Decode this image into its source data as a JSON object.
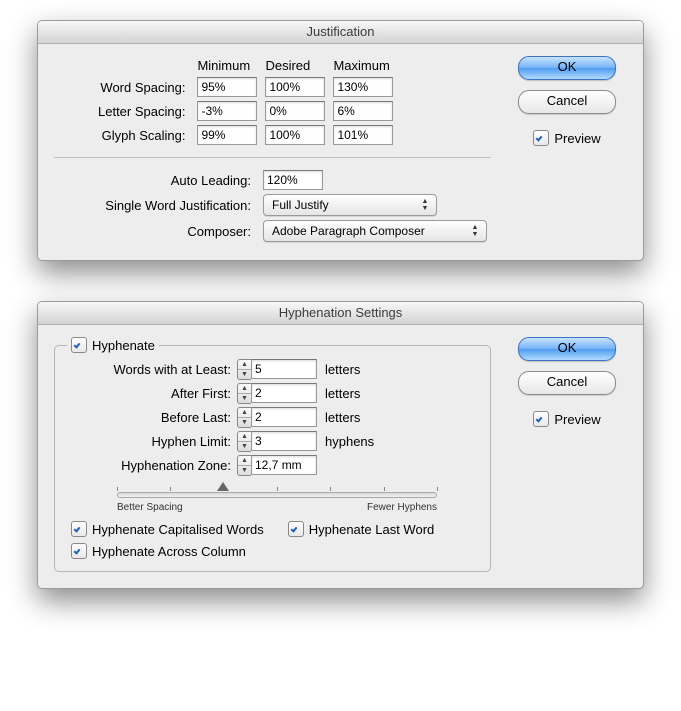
{
  "justification": {
    "title": "Justification",
    "columns": {
      "min": "Minimum",
      "des": "Desired",
      "max": "Maximum"
    },
    "rows": {
      "word": {
        "label": "Word Spacing:",
        "min": "95%",
        "des": "100%",
        "max": "130%"
      },
      "letter": {
        "label": "Letter Spacing:",
        "min": "-3%",
        "des": "0%",
        "max": "6%"
      },
      "glyph": {
        "label": "Glyph Scaling:",
        "min": "99%",
        "des": "100%",
        "max": "101%"
      }
    },
    "auto_leading": {
      "label": "Auto Leading:",
      "value": "120%"
    },
    "single_word": {
      "label": "Single Word Justification:",
      "value": "Full Justify"
    },
    "composer": {
      "label": "Composer:",
      "value": "Adobe Paragraph Composer"
    },
    "buttons": {
      "ok": "OK",
      "cancel": "Cancel"
    },
    "preview": "Preview"
  },
  "hyphenation": {
    "title": "Hyphenation Settings",
    "hyphenate": "Hyphenate",
    "rows": {
      "words_at_least": {
        "label": "Words with at Least:",
        "value": "5",
        "unit": "letters"
      },
      "after_first": {
        "label": "After First:",
        "value": "2",
        "unit": "letters"
      },
      "before_last": {
        "label": "Before Last:",
        "value": "2",
        "unit": "letters"
      },
      "limit": {
        "label": "Hyphen Limit:",
        "value": "3",
        "unit": "hyphens"
      },
      "zone": {
        "label": "Hyphenation Zone:",
        "value": "12,7 mm",
        "unit": ""
      }
    },
    "slider": {
      "left": "Better Spacing",
      "right": "Fewer Hyphens",
      "pos_pct": 33
    },
    "checks": {
      "cap": "Hyphenate Capitalised Words",
      "last": "Hyphenate Last Word",
      "column": "Hyphenate Across Column"
    },
    "buttons": {
      "ok": "OK",
      "cancel": "Cancel"
    },
    "preview": "Preview"
  }
}
